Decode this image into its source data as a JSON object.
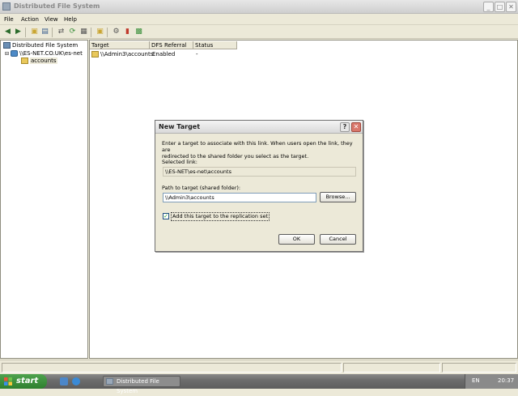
{
  "window": {
    "title": "Distributed File System"
  },
  "menu": {
    "file": "File",
    "action": "Action",
    "view": "View",
    "help": "Help"
  },
  "tree": {
    "root": "Distributed File System",
    "namespace": "\\\\ES-NET.CO.UK\\es-net",
    "link": "accounts"
  },
  "list": {
    "columns": [
      "Target",
      "DFS Referral",
      "Status"
    ],
    "rows": [
      {
        "target": "\\\\Admin3\\accounts",
        "referral": "Enabled",
        "status": "-"
      }
    ]
  },
  "dialog": {
    "title": "New Target",
    "help_symbol": "?",
    "close_symbol": "✕",
    "description_line1": "Enter a target to associate with this link. When users open the link, they are",
    "description_line2": "redirected to the shared folder you select as the target.",
    "selected_link_label": "Selected link:",
    "selected_link_value": "\\\\ES-NET\\es-net\\accounts",
    "path_label": "Path to target (shared folder):",
    "path_value": "\\\\Admin3\\accounts",
    "browse_label": "Browse...",
    "checkbox_label": "Add this target to the replication set",
    "checkbox_checked": true,
    "ok_label": "OK",
    "cancel_label": "Cancel"
  },
  "taskbar": {
    "start_label": "start",
    "task_label": "Distributed File System",
    "language": "EN",
    "clock": "20:37"
  },
  "colors": {
    "dialog_close": "#d9776b",
    "start_button": "#3a8f3a"
  }
}
